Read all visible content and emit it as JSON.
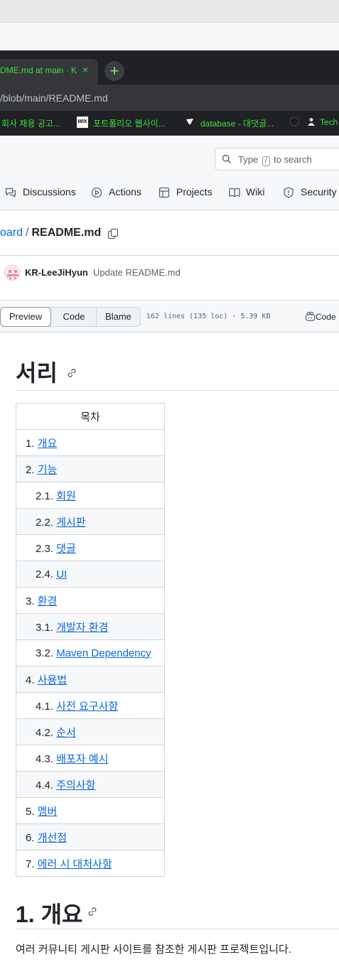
{
  "browser": {
    "tab_title": "DME.md at main · K",
    "tab_close": "×",
    "new_tab": "+",
    "url": "/blob/main/README.md",
    "bookmarks": [
      {
        "label": "회사 채용 공고...",
        "icon": "page-icon"
      },
      {
        "label": "포트폴리오 웹사이...",
        "icon": "wix-icon",
        "icon_text": "WIX"
      },
      {
        "label": "database - 대댓글...",
        "icon": "velog-icon"
      },
      {
        "label": "Tech",
        "icon": "github-icon"
      }
    ]
  },
  "header": {
    "search": {
      "before": "Type",
      "key": "/",
      "after": "to search"
    },
    "nav": [
      {
        "label": "Discussions",
        "icon": "discussions-icon"
      },
      {
        "label": "Actions",
        "icon": "play-icon"
      },
      {
        "label": "Projects",
        "icon": "table-icon"
      },
      {
        "label": "Wiki",
        "icon": "book-icon"
      },
      {
        "label": "Security",
        "icon": "shield-icon"
      }
    ]
  },
  "breadcrumb": {
    "repo": "oard",
    "sep": "/",
    "file": "README.md"
  },
  "commit": {
    "author": "KR-LeeJiHyun",
    "message": "Update README.md"
  },
  "file_toolbar": {
    "preview": "Preview",
    "code": "Code",
    "blame": "Blame",
    "meta": "162 lines (135 loc) · 5.39 KB",
    "code_btn": "Code"
  },
  "markdown": {
    "title": "서리",
    "toc_header": "목차",
    "toc": [
      {
        "num": "1.",
        "label": "개요",
        "level": 1
      },
      {
        "num": "2.",
        "label": "기능",
        "level": 1
      },
      {
        "num": "2.1.",
        "label": "회원",
        "level": 2
      },
      {
        "num": "2.2.",
        "label": "게시판",
        "level": 2
      },
      {
        "num": "2.3.",
        "label": "댓글",
        "level": 2
      },
      {
        "num": "2.4.",
        "label": "UI",
        "level": 2
      },
      {
        "num": "3.",
        "label": "환경",
        "level": 1
      },
      {
        "num": "3.1.",
        "label": "개발자 환경",
        "level": 2
      },
      {
        "num": "3.2.",
        "label": "Maven Dependency",
        "level": 2
      },
      {
        "num": "4.",
        "label": "사용법",
        "level": 1
      },
      {
        "num": "4.1.",
        "label": "사전 요구사항",
        "level": 2
      },
      {
        "num": "4.2.",
        "label": "순서",
        "level": 2
      },
      {
        "num": "4.3.",
        "label": "배포자 예시",
        "level": 2
      },
      {
        "num": "4.4.",
        "label": "주의사항",
        "level": 2
      },
      {
        "num": "5.",
        "label": "멤버",
        "level": 1
      },
      {
        "num": "6.",
        "label": "개선점",
        "level": 1
      },
      {
        "num": "7.",
        "label": "에러 시 대처사항",
        "level": 1
      }
    ],
    "section1_title": "1. 개요",
    "section1_text": "여러 커뮤니티 게시판 사이트를 참조한 게시판 프로젝트입니다."
  },
  "colors": {
    "link": "#0969da",
    "tab_text": "#3ddc3d",
    "chrome_dark": "#202124"
  }
}
